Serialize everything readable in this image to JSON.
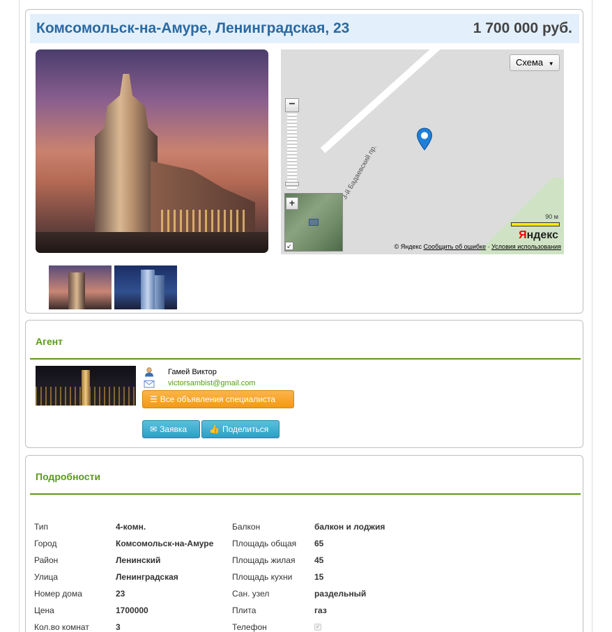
{
  "listing": {
    "address": "Комсомольск-на-Амуре, Ленинградская, 23",
    "price": "1 700 000 руб."
  },
  "map": {
    "scheme_label": "Схема",
    "street_label": "3-й Бадаевский пр.",
    "scale_label": "90 м",
    "logo_first": "Я",
    "logo_rest": "ндекс",
    "copyright": "© Яндекс",
    "report_error": "Сообщить об ошибке",
    "terms": "Условия использования",
    "zoom_in": "+",
    "zoom_out": "−"
  },
  "agent": {
    "section_title": "Агент",
    "name": "Гамей Виктор",
    "email": "victorsambist@gmail.com",
    "all_listings_label": "Все объявления специалиста",
    "request_label": "Заявка",
    "share_label": "Поделиться"
  },
  "details": {
    "section_title": "Подробности",
    "left": [
      {
        "label": "Тип",
        "value": "4-комн."
      },
      {
        "label": "Город",
        "value": "Комсомольск-на-Амуре"
      },
      {
        "label": "Район",
        "value": "Ленинский"
      },
      {
        "label": "Улица",
        "value": "Ленинградская"
      },
      {
        "label": "Номер дома",
        "value": "23"
      },
      {
        "label": "Цена",
        "value": "1700000"
      },
      {
        "label": "Кол.во комнат",
        "value": "3"
      }
    ],
    "right": [
      {
        "label": "Балкон",
        "value": "балкон и лоджия"
      },
      {
        "label": "Площадь общая",
        "value": "65"
      },
      {
        "label": "Площадь жилая",
        "value": "45"
      },
      {
        "label": "Площадь кухни",
        "value": "15"
      },
      {
        "label": "Сан. узел",
        "value": "раздельный"
      },
      {
        "label": "Плита",
        "value": "газ"
      },
      {
        "label": "Телефон",
        "value": ""
      }
    ]
  },
  "icons": {
    "user": "user-icon",
    "mail": "mail-icon",
    "list": "list-icon",
    "envelope": "envelope-icon",
    "thumbs_up": "thumbs-up-icon",
    "map_pin": "map-pin-icon"
  },
  "colors": {
    "title_blue": "#2a6aa3",
    "section_green": "#5a9a16",
    "orange_button": "#f39a12",
    "blue_button": "#2f9ec4"
  }
}
